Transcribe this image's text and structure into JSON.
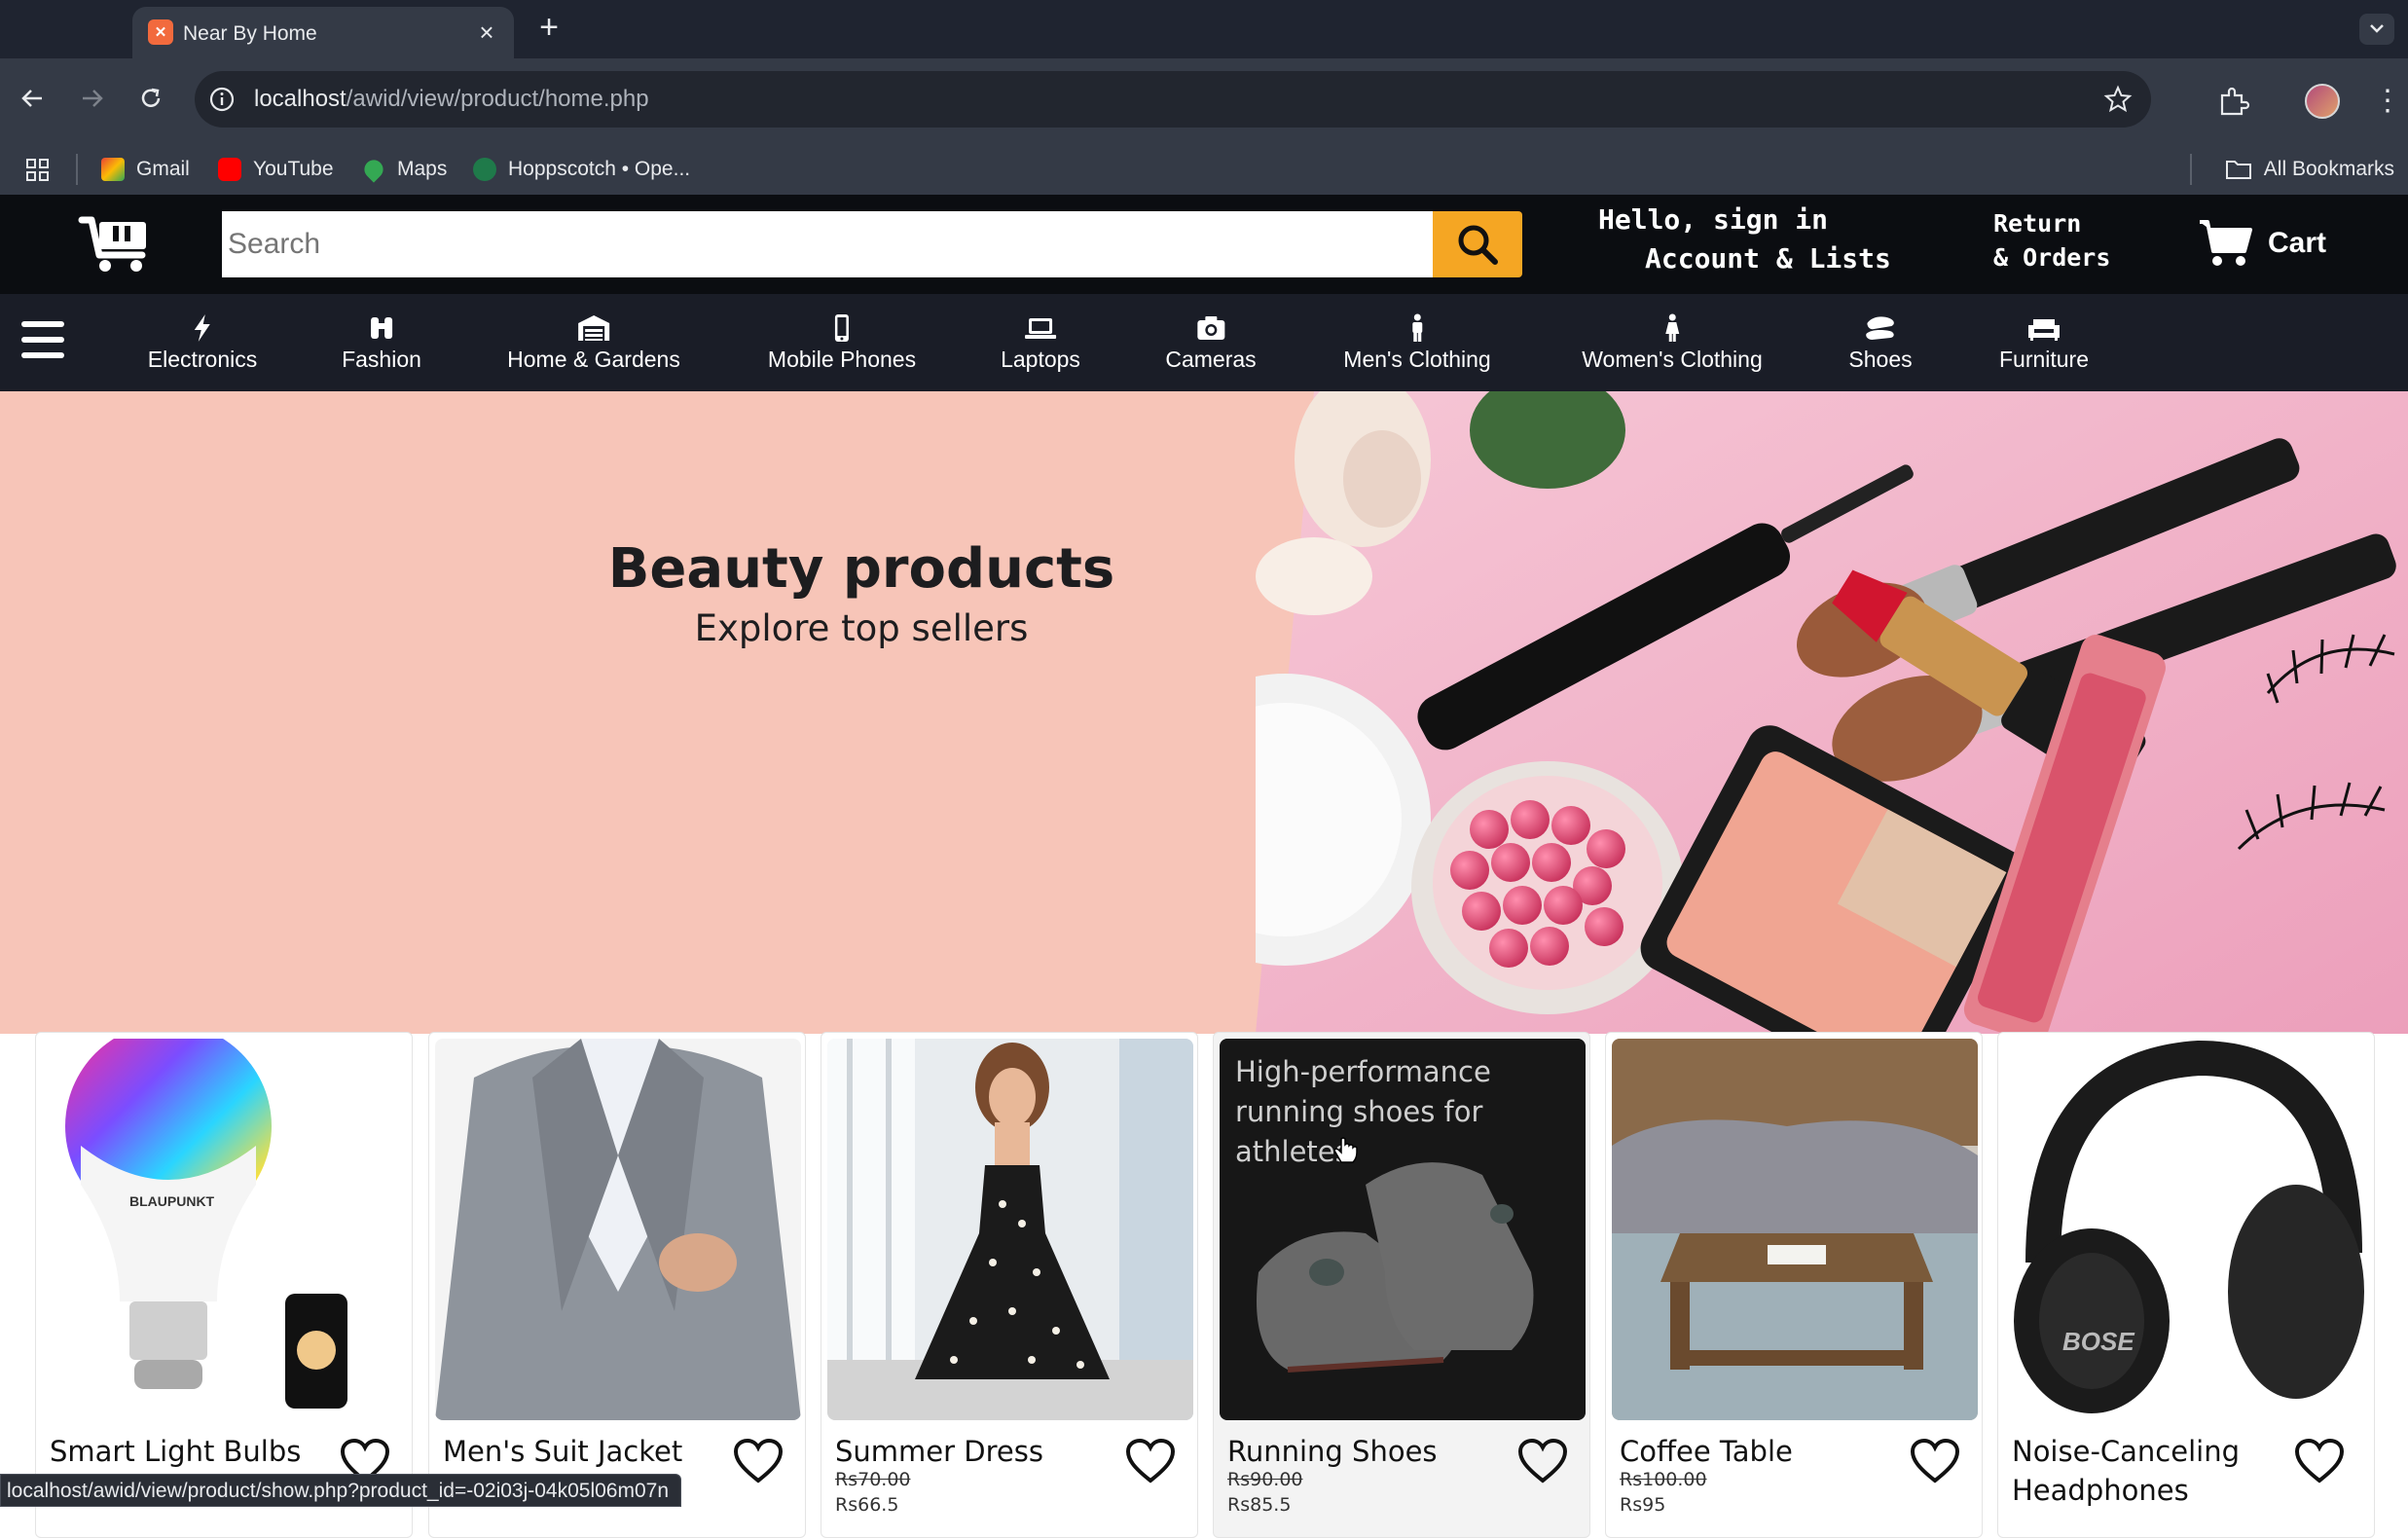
{
  "browser": {
    "tab_title": "Near By Home",
    "url_host": "localhost",
    "url_path": "/awid/view/product/home.php",
    "bookmarks": [
      {
        "label": "Gmail",
        "color": "#ea4335"
      },
      {
        "label": "YouTube",
        "color": "#ff0000"
      },
      {
        "label": "Maps",
        "color": "#34a853"
      },
      {
        "label": "Hoppscotch • Ope...",
        "color": "#1f7a4a"
      }
    ],
    "all_bookmarks": "All Bookmarks",
    "status_url": "localhost/awid/view/product/show.php?product_id=-02i03j-04k05l06m07n"
  },
  "header": {
    "search_placeholder": "Search",
    "hello": "Hello, sign in",
    "account": "Account & Lists",
    "returns": "Return",
    "orders": "& Orders",
    "cart": "Cart",
    "accent": "#f5a623"
  },
  "categories": [
    {
      "label": "Electronics",
      "icon": "bolt-icon"
    },
    {
      "label": "Fashion",
      "icon": "binoculars-icon"
    },
    {
      "label": "Home & Gardens",
      "icon": "warehouse-icon"
    },
    {
      "label": "Mobile Phones",
      "icon": "mobile-icon"
    },
    {
      "label": "Laptops",
      "icon": "laptop-icon"
    },
    {
      "label": "Cameras",
      "icon": "camera-icon"
    },
    {
      "label": "Men's Clothing",
      "icon": "male-icon"
    },
    {
      "label": "Women's Clothing",
      "icon": "female-icon"
    },
    {
      "label": "Shoes",
      "icon": "shoe-icon"
    },
    {
      "label": "Furniture",
      "icon": "couch-icon"
    }
  ],
  "hero": {
    "title": "Beauty products",
    "subtitle": "Explore top sellers"
  },
  "products": [
    {
      "name": "Smart Light Bulbs",
      "old_price": "",
      "new_price": ""
    },
    {
      "name": "Men's Suit Jacket",
      "old_price": "",
      "new_price": ""
    },
    {
      "name": "Summer Dress",
      "old_price": "Rs70.00",
      "new_price": "Rs66.5"
    },
    {
      "name": "Running Shoes",
      "old_price": "Rs90.00",
      "new_price": "Rs85.5",
      "hover_text": "High-performance running shoes for athletes"
    },
    {
      "name": "Coffee Table",
      "old_price": "Rs100.00",
      "new_price": "Rs95"
    },
    {
      "name": "Noise-Canceling Headphones",
      "old_price": "",
      "new_price": ""
    }
  ]
}
